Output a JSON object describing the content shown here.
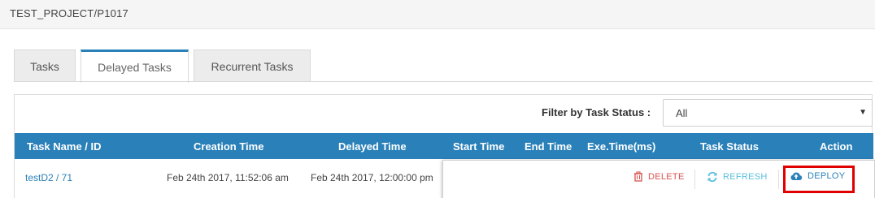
{
  "header": {
    "breadcrumb": "TEST_PROJECT/P1017"
  },
  "tabs": [
    {
      "label": "Tasks",
      "active": false
    },
    {
      "label": "Delayed Tasks",
      "active": true
    },
    {
      "label": "Recurrent Tasks",
      "active": false
    }
  ],
  "filter": {
    "label": "Filter by Task Status :",
    "selected": "All"
  },
  "table": {
    "columns": [
      "Task Name / ID",
      "Creation Time",
      "Delayed Time",
      "Start Time",
      "End Time",
      "Exe.Time(ms)",
      "Task Status",
      "Action"
    ],
    "rows": [
      {
        "task": "testD2 / 71",
        "creation_time": "Feb 24th 2017, 11:52:06 am",
        "delayed_time": "Feb 24th 2017, 12:00:00 pm"
      }
    ]
  },
  "actions": {
    "delete": "DELETE",
    "refresh": "REFRESH",
    "deploy": "DEPLOY"
  },
  "colors": {
    "header_blue": "#2a80b9",
    "delete_red": "#d9534f",
    "refresh_cyan": "#5bc0de",
    "highlight_red": "#e00000"
  }
}
